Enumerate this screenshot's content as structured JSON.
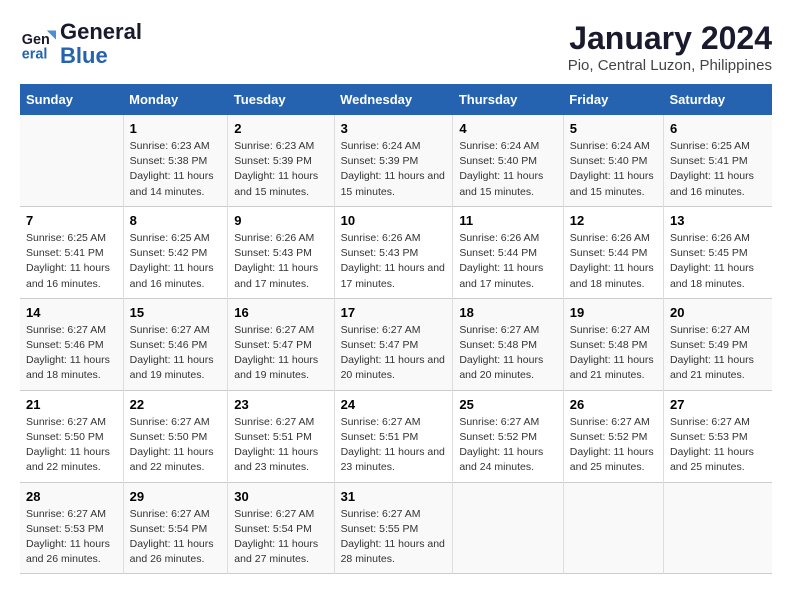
{
  "logo": {
    "line1": "General",
    "line2": "Blue"
  },
  "title": "January 2024",
  "subtitle": "Pio, Central Luzon, Philippines",
  "calendar": {
    "headers": [
      "Sunday",
      "Monday",
      "Tuesday",
      "Wednesday",
      "Thursday",
      "Friday",
      "Saturday"
    ],
    "rows": [
      [
        {
          "day": "",
          "info": ""
        },
        {
          "day": "1",
          "info": "Sunrise: 6:23 AM\nSunset: 5:38 PM\nDaylight: 11 hours and 14 minutes."
        },
        {
          "day": "2",
          "info": "Sunrise: 6:23 AM\nSunset: 5:39 PM\nDaylight: 11 hours and 15 minutes."
        },
        {
          "day": "3",
          "info": "Sunrise: 6:24 AM\nSunset: 5:39 PM\nDaylight: 11 hours and 15 minutes."
        },
        {
          "day": "4",
          "info": "Sunrise: 6:24 AM\nSunset: 5:40 PM\nDaylight: 11 hours and 15 minutes."
        },
        {
          "day": "5",
          "info": "Sunrise: 6:24 AM\nSunset: 5:40 PM\nDaylight: 11 hours and 15 minutes."
        },
        {
          "day": "6",
          "info": "Sunrise: 6:25 AM\nSunset: 5:41 PM\nDaylight: 11 hours and 16 minutes."
        }
      ],
      [
        {
          "day": "7",
          "info": "Sunrise: 6:25 AM\nSunset: 5:41 PM\nDaylight: 11 hours and 16 minutes."
        },
        {
          "day": "8",
          "info": "Sunrise: 6:25 AM\nSunset: 5:42 PM\nDaylight: 11 hours and 16 minutes."
        },
        {
          "day": "9",
          "info": "Sunrise: 6:26 AM\nSunset: 5:43 PM\nDaylight: 11 hours and 17 minutes."
        },
        {
          "day": "10",
          "info": "Sunrise: 6:26 AM\nSunset: 5:43 PM\nDaylight: 11 hours and 17 minutes."
        },
        {
          "day": "11",
          "info": "Sunrise: 6:26 AM\nSunset: 5:44 PM\nDaylight: 11 hours and 17 minutes."
        },
        {
          "day": "12",
          "info": "Sunrise: 6:26 AM\nSunset: 5:44 PM\nDaylight: 11 hours and 18 minutes."
        },
        {
          "day": "13",
          "info": "Sunrise: 6:26 AM\nSunset: 5:45 PM\nDaylight: 11 hours and 18 minutes."
        }
      ],
      [
        {
          "day": "14",
          "info": "Sunrise: 6:27 AM\nSunset: 5:46 PM\nDaylight: 11 hours and 18 minutes."
        },
        {
          "day": "15",
          "info": "Sunrise: 6:27 AM\nSunset: 5:46 PM\nDaylight: 11 hours and 19 minutes."
        },
        {
          "day": "16",
          "info": "Sunrise: 6:27 AM\nSunset: 5:47 PM\nDaylight: 11 hours and 19 minutes."
        },
        {
          "day": "17",
          "info": "Sunrise: 6:27 AM\nSunset: 5:47 PM\nDaylight: 11 hours and 20 minutes."
        },
        {
          "day": "18",
          "info": "Sunrise: 6:27 AM\nSunset: 5:48 PM\nDaylight: 11 hours and 20 minutes."
        },
        {
          "day": "19",
          "info": "Sunrise: 6:27 AM\nSunset: 5:48 PM\nDaylight: 11 hours and 21 minutes."
        },
        {
          "day": "20",
          "info": "Sunrise: 6:27 AM\nSunset: 5:49 PM\nDaylight: 11 hours and 21 minutes."
        }
      ],
      [
        {
          "day": "21",
          "info": "Sunrise: 6:27 AM\nSunset: 5:50 PM\nDaylight: 11 hours and 22 minutes."
        },
        {
          "day": "22",
          "info": "Sunrise: 6:27 AM\nSunset: 5:50 PM\nDaylight: 11 hours and 22 minutes."
        },
        {
          "day": "23",
          "info": "Sunrise: 6:27 AM\nSunset: 5:51 PM\nDaylight: 11 hours and 23 minutes."
        },
        {
          "day": "24",
          "info": "Sunrise: 6:27 AM\nSunset: 5:51 PM\nDaylight: 11 hours and 23 minutes."
        },
        {
          "day": "25",
          "info": "Sunrise: 6:27 AM\nSunset: 5:52 PM\nDaylight: 11 hours and 24 minutes."
        },
        {
          "day": "26",
          "info": "Sunrise: 6:27 AM\nSunset: 5:52 PM\nDaylight: 11 hours and 25 minutes."
        },
        {
          "day": "27",
          "info": "Sunrise: 6:27 AM\nSunset: 5:53 PM\nDaylight: 11 hours and 25 minutes."
        }
      ],
      [
        {
          "day": "28",
          "info": "Sunrise: 6:27 AM\nSunset: 5:53 PM\nDaylight: 11 hours and 26 minutes."
        },
        {
          "day": "29",
          "info": "Sunrise: 6:27 AM\nSunset: 5:54 PM\nDaylight: 11 hours and 26 minutes."
        },
        {
          "day": "30",
          "info": "Sunrise: 6:27 AM\nSunset: 5:54 PM\nDaylight: 11 hours and 27 minutes."
        },
        {
          "day": "31",
          "info": "Sunrise: 6:27 AM\nSunset: 5:55 PM\nDaylight: 11 hours and 28 minutes."
        },
        {
          "day": "",
          "info": ""
        },
        {
          "day": "",
          "info": ""
        },
        {
          "day": "",
          "info": ""
        }
      ]
    ]
  }
}
